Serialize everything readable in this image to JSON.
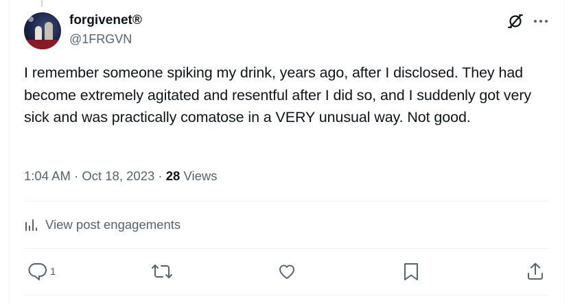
{
  "author": {
    "display_name": "forgivenet®",
    "handle": "@1FRGVN"
  },
  "post": {
    "text": "I remember someone spiking my drink, years ago, after I disclosed. They had become extremely agitated and resentful after I did so, and I suddenly got very sick and was practically comatose in a VERY unusual way. Not good.",
    "time": "1:04 AM",
    "separator": "·",
    "date": "Oct 18, 2023",
    "views_count": "28",
    "views_label": "Views"
  },
  "engagements": {
    "label": "View post engagements"
  },
  "actions": {
    "reply_count": "1",
    "repost_count": "",
    "like_count": "",
    "bookmark_count": ""
  },
  "icons": {
    "grok": "grok-icon",
    "more": "more-icon",
    "analytics": "analytics-icon",
    "reply": "reply-icon",
    "repost": "repost-icon",
    "like": "heart-icon",
    "bookmark": "bookmark-icon",
    "share": "share-icon"
  },
  "colors": {
    "text_primary": "#0f1419",
    "text_secondary": "#536471",
    "divider": "#eff3f4"
  }
}
